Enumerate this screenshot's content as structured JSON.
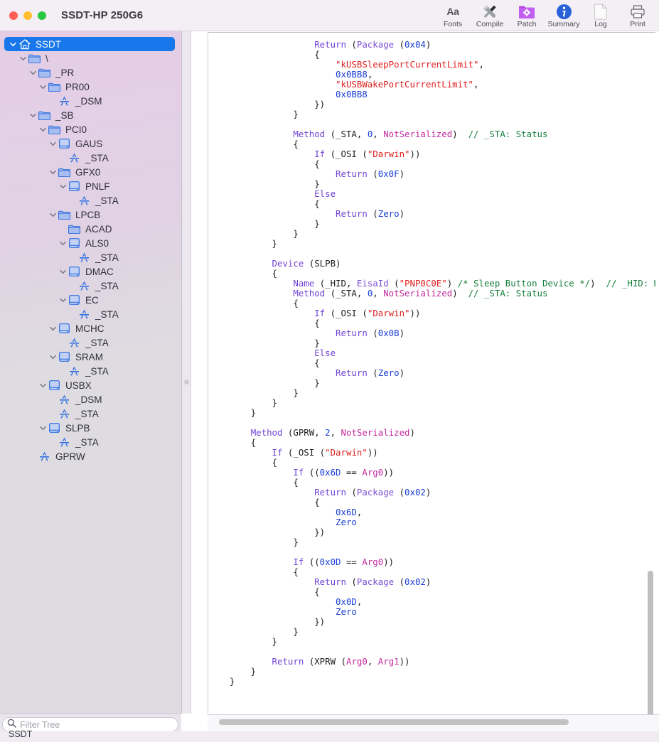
{
  "window": {
    "title": "SSDT-HP 250G6",
    "controls": [
      {
        "name": "close",
        "color": "#ff5f57"
      },
      {
        "name": "minimize",
        "color": "#febc2e"
      },
      {
        "name": "zoom",
        "color": "#28c840"
      }
    ]
  },
  "toolbar": {
    "items": [
      {
        "label": "Fonts",
        "icon": "fonts-aa-icon"
      },
      {
        "label": "Compile",
        "icon": "compile-tools-icon"
      },
      {
        "label": "Patch",
        "icon": "patch-folder-gear-icon"
      },
      {
        "label": "Summary",
        "icon": "summary-info-icon"
      },
      {
        "label": "Log",
        "icon": "log-page-icon"
      },
      {
        "label": "Print",
        "icon": "print-printer-icon"
      }
    ]
  },
  "sidebar": {
    "selected": "SSDT",
    "filter": {
      "value": "",
      "placeholder": "Filter Tree"
    },
    "tree": [
      {
        "label": "SSDT",
        "depth": 0,
        "icon": "home",
        "chev": "down",
        "selected": true
      },
      {
        "label": "\\",
        "depth": 1,
        "icon": "folder",
        "chev": "down"
      },
      {
        "label": "_PR",
        "depth": 2,
        "icon": "folder",
        "chev": "down"
      },
      {
        "label": "PR00",
        "depth": 3,
        "icon": "folder",
        "chev": "down"
      },
      {
        "label": "_DSM",
        "depth": 4,
        "icon": "method",
        "chev": "none"
      },
      {
        "label": "_SB",
        "depth": 2,
        "icon": "folder",
        "chev": "down"
      },
      {
        "label": "PCI0",
        "depth": 3,
        "icon": "folder",
        "chev": "down"
      },
      {
        "label": "GAUS",
        "depth": 4,
        "icon": "device",
        "chev": "down"
      },
      {
        "label": "_STA",
        "depth": 5,
        "icon": "method",
        "chev": "none"
      },
      {
        "label": "GFX0",
        "depth": 4,
        "icon": "folder",
        "chev": "down"
      },
      {
        "label": "PNLF",
        "depth": 5,
        "icon": "device",
        "chev": "down"
      },
      {
        "label": "_STA",
        "depth": 6,
        "icon": "method",
        "chev": "none"
      },
      {
        "label": "LPCB",
        "depth": 4,
        "icon": "folder",
        "chev": "down"
      },
      {
        "label": "ACAD",
        "depth": 5,
        "icon": "folder",
        "chev": "none"
      },
      {
        "label": "ALS0",
        "depth": 5,
        "icon": "device",
        "chev": "down"
      },
      {
        "label": "_STA",
        "depth": 6,
        "icon": "method",
        "chev": "none"
      },
      {
        "label": "DMAC",
        "depth": 5,
        "icon": "device",
        "chev": "down"
      },
      {
        "label": "_STA",
        "depth": 6,
        "icon": "method",
        "chev": "none"
      },
      {
        "label": "EC",
        "depth": 5,
        "icon": "device",
        "chev": "down"
      },
      {
        "label": "_STA",
        "depth": 6,
        "icon": "method",
        "chev": "none"
      },
      {
        "label": "MCHC",
        "depth": 4,
        "icon": "device",
        "chev": "down"
      },
      {
        "label": "_STA",
        "depth": 5,
        "icon": "method",
        "chev": "none"
      },
      {
        "label": "SRAM",
        "depth": 4,
        "icon": "device",
        "chev": "down"
      },
      {
        "label": "_STA",
        "depth": 5,
        "icon": "method",
        "chev": "none"
      },
      {
        "label": "USBX",
        "depth": 3,
        "icon": "device",
        "chev": "down"
      },
      {
        "label": "_DSM",
        "depth": 4,
        "icon": "method",
        "chev": "none"
      },
      {
        "label": "_STA",
        "depth": 4,
        "icon": "method",
        "chev": "none"
      },
      {
        "label": "SLPB",
        "depth": 3,
        "icon": "device",
        "chev": "down"
      },
      {
        "label": "_STA",
        "depth": 4,
        "icon": "method",
        "chev": "none"
      },
      {
        "label": "GPRW",
        "depth": 2,
        "icon": "method",
        "chev": "none"
      }
    ]
  },
  "editor": {
    "language": "ACPI ASL",
    "colors": {
      "keyword": "#6f42d4",
      "function": "#7b4fd6",
      "number": "#1a3fd6",
      "string": "#e02020",
      "comment": "#17803d",
      "magenta": "#c32ba0",
      "plain": "#1d1d1d"
    },
    "lines": [
      [
        {
          "t": "                    ",
          "c": "pl"
        },
        {
          "t": "Return",
          "c": "kw"
        },
        {
          "t": " (",
          "c": "pl"
        },
        {
          "t": "Package",
          "c": "fn"
        },
        {
          "t": " (",
          "c": "pl"
        },
        {
          "t": "0x04",
          "c": "num"
        },
        {
          "t": ")",
          "c": "pl"
        }
      ],
      [
        {
          "t": "                    {",
          "c": "pl"
        }
      ],
      [
        {
          "t": "                        ",
          "c": "pl"
        },
        {
          "t": "\"kUSBSleepPortCurrentLimit\"",
          "c": "str"
        },
        {
          "t": ",",
          "c": "pl"
        }
      ],
      [
        {
          "t": "                        ",
          "c": "pl"
        },
        {
          "t": "0x0BB8",
          "c": "num"
        },
        {
          "t": ",",
          "c": "pl"
        }
      ],
      [
        {
          "t": "                        ",
          "c": "pl"
        },
        {
          "t": "\"kUSBWakePortCurrentLimit\"",
          "c": "str"
        },
        {
          "t": ",",
          "c": "pl"
        }
      ],
      [
        {
          "t": "                        ",
          "c": "pl"
        },
        {
          "t": "0x0BB8",
          "c": "num"
        }
      ],
      [
        {
          "t": "                    })",
          "c": "pl"
        }
      ],
      [
        {
          "t": "                }",
          "c": "pl"
        }
      ],
      [
        {
          "t": "",
          "c": "pl"
        }
      ],
      [
        {
          "t": "                ",
          "c": "pl"
        },
        {
          "t": "Method",
          "c": "kw"
        },
        {
          "t": " (_STA, ",
          "c": "pl"
        },
        {
          "t": "0",
          "c": "num"
        },
        {
          "t": ", ",
          "c": "pl"
        },
        {
          "t": "NotSerialized",
          "c": "mag"
        },
        {
          "t": ")  ",
          "c": "pl"
        },
        {
          "t": "// _STA: Status",
          "c": "cmt"
        }
      ],
      [
        {
          "t": "                {",
          "c": "pl"
        }
      ],
      [
        {
          "t": "                    ",
          "c": "pl"
        },
        {
          "t": "If",
          "c": "kw"
        },
        {
          "t": " (_OSI (",
          "c": "pl"
        },
        {
          "t": "\"Darwin\"",
          "c": "str"
        },
        {
          "t": "))",
          "c": "pl"
        }
      ],
      [
        {
          "t": "                    {",
          "c": "pl"
        }
      ],
      [
        {
          "t": "                        ",
          "c": "pl"
        },
        {
          "t": "Return",
          "c": "kw"
        },
        {
          "t": " (",
          "c": "pl"
        },
        {
          "t": "0x0F",
          "c": "num"
        },
        {
          "t": ")",
          "c": "pl"
        }
      ],
      [
        {
          "t": "                    }",
          "c": "pl"
        }
      ],
      [
        {
          "t": "                    ",
          "c": "pl"
        },
        {
          "t": "Else",
          "c": "kw"
        }
      ],
      [
        {
          "t": "                    {",
          "c": "pl"
        }
      ],
      [
        {
          "t": "                        ",
          "c": "pl"
        },
        {
          "t": "Return",
          "c": "kw"
        },
        {
          "t": " (",
          "c": "pl"
        },
        {
          "t": "Zero",
          "c": "num"
        },
        {
          "t": ")",
          "c": "pl"
        }
      ],
      [
        {
          "t": "                    }",
          "c": "pl"
        }
      ],
      [
        {
          "t": "                }",
          "c": "pl"
        }
      ],
      [
        {
          "t": "            }",
          "c": "pl"
        }
      ],
      [
        {
          "t": "",
          "c": "pl"
        }
      ],
      [
        {
          "t": "            ",
          "c": "pl"
        },
        {
          "t": "Device",
          "c": "kw"
        },
        {
          "t": " (SLPB)",
          "c": "pl"
        }
      ],
      [
        {
          "t": "            {",
          "c": "pl"
        }
      ],
      [
        {
          "t": "                ",
          "c": "pl"
        },
        {
          "t": "Name",
          "c": "kw"
        },
        {
          "t": " (_HID, ",
          "c": "pl"
        },
        {
          "t": "EisaId",
          "c": "fn"
        },
        {
          "t": " (",
          "c": "pl"
        },
        {
          "t": "\"PNP0C0E\"",
          "c": "str"
        },
        {
          "t": ") ",
          "c": "pl"
        },
        {
          "t": "/* Sleep Button Device */",
          "c": "cmt"
        },
        {
          "t": ")  ",
          "c": "pl"
        },
        {
          "t": "// _HID: Har",
          "c": "cmt"
        }
      ],
      [
        {
          "t": "                ",
          "c": "pl"
        },
        {
          "t": "Method",
          "c": "kw"
        },
        {
          "t": " (_STA, ",
          "c": "pl"
        },
        {
          "t": "0",
          "c": "num"
        },
        {
          "t": ", ",
          "c": "pl"
        },
        {
          "t": "NotSerialized",
          "c": "mag"
        },
        {
          "t": ")  ",
          "c": "pl"
        },
        {
          "t": "// _STA: Status",
          "c": "cmt"
        }
      ],
      [
        {
          "t": "                {",
          "c": "pl"
        }
      ],
      [
        {
          "t": "                    ",
          "c": "pl"
        },
        {
          "t": "If",
          "c": "kw"
        },
        {
          "t": " (_OSI (",
          "c": "pl"
        },
        {
          "t": "\"Darwin\"",
          "c": "str"
        },
        {
          "t": "))",
          "c": "pl"
        }
      ],
      [
        {
          "t": "                    {",
          "c": "pl"
        }
      ],
      [
        {
          "t": "                        ",
          "c": "pl"
        },
        {
          "t": "Return",
          "c": "kw"
        },
        {
          "t": " (",
          "c": "pl"
        },
        {
          "t": "0x0B",
          "c": "num"
        },
        {
          "t": ")",
          "c": "pl"
        }
      ],
      [
        {
          "t": "                    }",
          "c": "pl"
        }
      ],
      [
        {
          "t": "                    ",
          "c": "pl"
        },
        {
          "t": "Else",
          "c": "kw"
        }
      ],
      [
        {
          "t": "                    {",
          "c": "pl"
        }
      ],
      [
        {
          "t": "                        ",
          "c": "pl"
        },
        {
          "t": "Return",
          "c": "kw"
        },
        {
          "t": " (",
          "c": "pl"
        },
        {
          "t": "Zero",
          "c": "num"
        },
        {
          "t": ")",
          "c": "pl"
        }
      ],
      [
        {
          "t": "                    }",
          "c": "pl"
        }
      ],
      [
        {
          "t": "                }",
          "c": "pl"
        }
      ],
      [
        {
          "t": "            }",
          "c": "pl"
        }
      ],
      [
        {
          "t": "        }",
          "c": "pl"
        }
      ],
      [
        {
          "t": "",
          "c": "pl"
        }
      ],
      [
        {
          "t": "        ",
          "c": "pl"
        },
        {
          "t": "Method",
          "c": "kw"
        },
        {
          "t": " (GPRW, ",
          "c": "pl"
        },
        {
          "t": "2",
          "c": "num"
        },
        {
          "t": ", ",
          "c": "pl"
        },
        {
          "t": "NotSerialized",
          "c": "mag"
        },
        {
          "t": ")",
          "c": "pl"
        }
      ],
      [
        {
          "t": "        {",
          "c": "pl"
        }
      ],
      [
        {
          "t": "            ",
          "c": "pl"
        },
        {
          "t": "If",
          "c": "kw"
        },
        {
          "t": " (_OSI (",
          "c": "pl"
        },
        {
          "t": "\"Darwin\"",
          "c": "str"
        },
        {
          "t": "))",
          "c": "pl"
        }
      ],
      [
        {
          "t": "            {",
          "c": "pl"
        }
      ],
      [
        {
          "t": "                ",
          "c": "pl"
        },
        {
          "t": "If",
          "c": "kw"
        },
        {
          "t": " ((",
          "c": "pl"
        },
        {
          "t": "0x6D",
          "c": "num"
        },
        {
          "t": " == ",
          "c": "pl"
        },
        {
          "t": "Arg0",
          "c": "mag"
        },
        {
          "t": "))",
          "c": "pl"
        }
      ],
      [
        {
          "t": "                {",
          "c": "pl"
        }
      ],
      [
        {
          "t": "                    ",
          "c": "pl"
        },
        {
          "t": "Return",
          "c": "kw"
        },
        {
          "t": " (",
          "c": "pl"
        },
        {
          "t": "Package",
          "c": "fn"
        },
        {
          "t": " (",
          "c": "pl"
        },
        {
          "t": "0x02",
          "c": "num"
        },
        {
          "t": ")",
          "c": "pl"
        }
      ],
      [
        {
          "t": "                    {",
          "c": "pl"
        }
      ],
      [
        {
          "t": "                        ",
          "c": "pl"
        },
        {
          "t": "0x6D",
          "c": "num"
        },
        {
          "t": ",",
          "c": "pl"
        }
      ],
      [
        {
          "t": "                        ",
          "c": "pl"
        },
        {
          "t": "Zero",
          "c": "num"
        }
      ],
      [
        {
          "t": "                    })",
          "c": "pl"
        }
      ],
      [
        {
          "t": "                }",
          "c": "pl"
        }
      ],
      [
        {
          "t": "",
          "c": "pl"
        }
      ],
      [
        {
          "t": "                ",
          "c": "pl"
        },
        {
          "t": "If",
          "c": "kw"
        },
        {
          "t": " ((",
          "c": "pl"
        },
        {
          "t": "0x0D",
          "c": "num"
        },
        {
          "t": " == ",
          "c": "pl"
        },
        {
          "t": "Arg0",
          "c": "mag"
        },
        {
          "t": "))",
          "c": "pl"
        }
      ],
      [
        {
          "t": "                {",
          "c": "pl"
        }
      ],
      [
        {
          "t": "                    ",
          "c": "pl"
        },
        {
          "t": "Return",
          "c": "kw"
        },
        {
          "t": " (",
          "c": "pl"
        },
        {
          "t": "Package",
          "c": "fn"
        },
        {
          "t": " (",
          "c": "pl"
        },
        {
          "t": "0x02",
          "c": "num"
        },
        {
          "t": ")",
          "c": "pl"
        }
      ],
      [
        {
          "t": "                    {",
          "c": "pl"
        }
      ],
      [
        {
          "t": "                        ",
          "c": "pl"
        },
        {
          "t": "0x0D",
          "c": "num"
        },
        {
          "t": ",",
          "c": "pl"
        }
      ],
      [
        {
          "t": "                        ",
          "c": "pl"
        },
        {
          "t": "Zero",
          "c": "num"
        }
      ],
      [
        {
          "t": "                    })",
          "c": "pl"
        }
      ],
      [
        {
          "t": "                }",
          "c": "pl"
        }
      ],
      [
        {
          "t": "            }",
          "c": "pl"
        }
      ],
      [
        {
          "t": "",
          "c": "pl"
        }
      ],
      [
        {
          "t": "            ",
          "c": "pl"
        },
        {
          "t": "Return",
          "c": "kw"
        },
        {
          "t": " (XPRW (",
          "c": "pl"
        },
        {
          "t": "Arg0",
          "c": "mag"
        },
        {
          "t": ", ",
          "c": "pl"
        },
        {
          "t": "Arg1",
          "c": "mag"
        },
        {
          "t": "))",
          "c": "pl"
        }
      ],
      [
        {
          "t": "        }",
          "c": "pl"
        }
      ],
      [
        {
          "t": "    }",
          "c": "pl"
        }
      ]
    ]
  },
  "statusbar": {
    "text": "SSDT"
  }
}
